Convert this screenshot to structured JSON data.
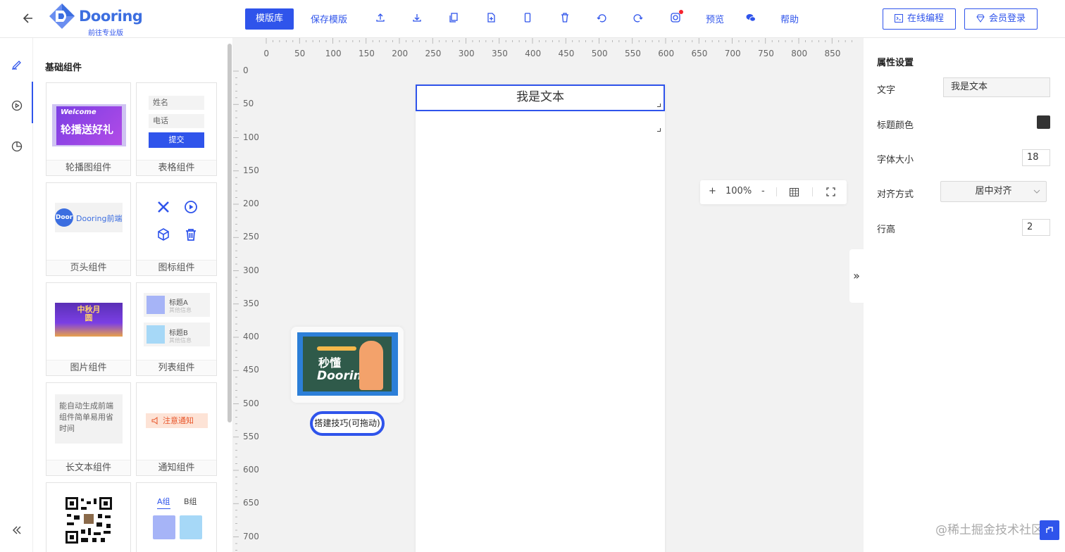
{
  "header": {
    "logo_text": "Dooring",
    "logo_sub": "前往专业版",
    "template_lib": "模版库",
    "save_template": "保存模版",
    "preview": "预览",
    "help": "帮助",
    "online_code": "在线编程",
    "member_login": "会员登录",
    "icons": [
      "upload-icon",
      "download-icon",
      "copy-icon",
      "file-icon",
      "phone-icon",
      "delete-icon",
      "undo-icon",
      "redo-icon",
      "instagram-icon",
      "wechat-icon"
    ]
  },
  "panel": {
    "title": "基础组件",
    "cards": [
      {
        "label": "轮播图组件",
        "preview_text": "轮播送好礼",
        "preview_sub": "Welcome"
      },
      {
        "label": "表格组件",
        "field1": "姓名",
        "field2": "电话",
        "submit": "提交"
      },
      {
        "label": "页头组件",
        "preview_text": "Dooring前端",
        "badge": "Door"
      },
      {
        "label": "图标组件"
      },
      {
        "label": "图片组件",
        "preview_text": "中秋月圆"
      },
      {
        "label": "列表组件",
        "item1": "标题A",
        "item1_sub": "其他信息",
        "item2": "标题B",
        "item2_sub": "其他信息"
      },
      {
        "label": "长文本组件",
        "preview_text": "能自动生成前端组件简单易用省时间"
      },
      {
        "label": "通知组件",
        "preview_text": "注意通知"
      },
      {
        "label": ""
      },
      {
        "label": "",
        "tab_a": "A组",
        "tab_b": "B组"
      }
    ]
  },
  "ruler": {
    "h_labels": [
      "0",
      "50",
      "100",
      "150",
      "200",
      "250",
      "300",
      "350",
      "400",
      "450",
      "500",
      "550",
      "600",
      "650",
      "700",
      "750",
      "800",
      "850"
    ],
    "v_labels": [
      "0",
      "50",
      "100",
      "150",
      "200",
      "250",
      "300",
      "350",
      "400",
      "450",
      "500",
      "550",
      "600",
      "650",
      "700"
    ]
  },
  "canvas": {
    "text_block": "我是文本",
    "zoom": "100%",
    "zoom_in": "+",
    "zoom_out": "-",
    "tip_button": "搭建技巧(可拖动)",
    "tip_title": "秒懂",
    "tip_brand": "Dooring"
  },
  "props": {
    "title": "属性设置",
    "text_label": "文字",
    "text_value": "我是文本",
    "color_label": "标题颜色",
    "color_value": "#333333",
    "size_label": "字体大小",
    "size_value": "18",
    "align_label": "对齐方式",
    "align_value": "居中对齐",
    "lineheight_label": "行高",
    "lineheight_value": "2"
  },
  "watermark": "@稀土掘金技术社区",
  "colors": {
    "accent": "#2f54eb"
  }
}
